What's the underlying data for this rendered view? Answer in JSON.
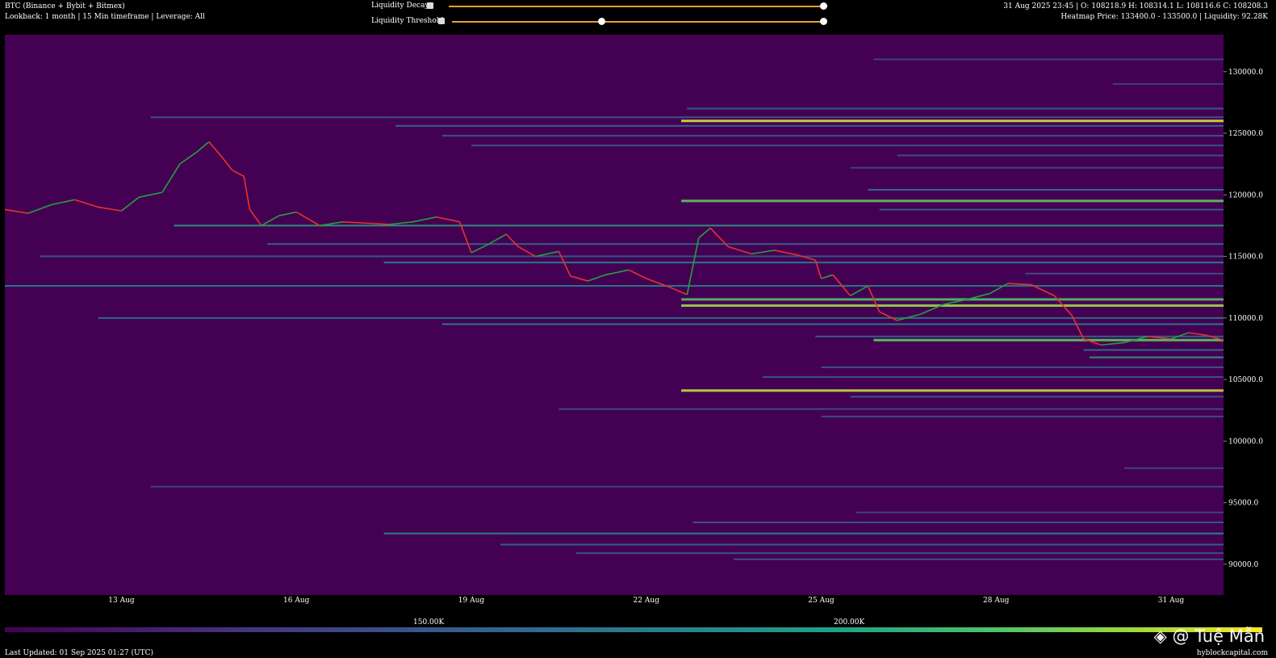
{
  "header": {
    "title": "BTC (Binance + Bybit + Bitmex)",
    "subtitle": "Lookback: 1 month | 15 Min timeframe | Leverage: All",
    "ohlc": "31 Aug 2025 23:45 | O: 108218.9 H: 108314.1 L: 108116.6 C: 108208.3",
    "heatmap_info": "Heatmap Price: 133400.0 - 133500.0 | Liquidity: 92.28K"
  },
  "controls": {
    "decay_label": "Liquidity Decay",
    "threshold_label": "Liquidity Threshold",
    "decay_range": [
      0.0,
      1.0
    ],
    "threshold_range": [
      0.4,
      1.0
    ]
  },
  "colorbar": {
    "label_1": "150.00K",
    "label_2": "200.00K",
    "colors": [
      "#440154",
      "#3b528b",
      "#21918c",
      "#5ec962",
      "#fde725"
    ]
  },
  "footer": {
    "updated": "Last Updated: 01 Sep 2025 01:27 (UTC)",
    "site": "hyblockcapital.com"
  },
  "watermark": "@ Tuệ Mẫn",
  "chart_data": {
    "type": "heatmap",
    "background_color": "#440154",
    "x_start_day": 11,
    "x_end_day": 31.9,
    "ylim": [
      87500,
      133000
    ],
    "x_ticks": [
      {
        "label": "13 Aug",
        "day": 13
      },
      {
        "label": "16 Aug",
        "day": 16
      },
      {
        "label": "19 Aug",
        "day": 19
      },
      {
        "label": "22 Aug",
        "day": 22
      },
      {
        "label": "25 Aug",
        "day": 25
      },
      {
        "label": "28 Aug",
        "day": 28
      },
      {
        "label": "31 Aug",
        "day": 31
      }
    ],
    "y_ticks": [
      {
        "label": "130000.0",
        "value": 130000
      },
      {
        "label": "125000.0",
        "value": 125000
      },
      {
        "label": "120000.0",
        "value": 120000
      },
      {
        "label": "115000.0",
        "value": 115000
      },
      {
        "label": "110000.0",
        "value": 110000
      },
      {
        "label": "105000.0",
        "value": 105000
      },
      {
        "label": "100000.0",
        "value": 100000
      },
      {
        "label": "95000.0",
        "value": 95000
      },
      {
        "label": "90000.0",
        "value": 90000
      }
    ],
    "price_series": [
      [
        11.0,
        118800
      ],
      [
        11.4,
        118500
      ],
      [
        11.8,
        119200
      ],
      [
        12.2,
        119600
      ],
      [
        12.6,
        119000
      ],
      [
        13.0,
        118700
      ],
      [
        13.3,
        119800
      ],
      [
        13.7,
        120200
      ],
      [
        14.0,
        122500
      ],
      [
        14.3,
        123500
      ],
      [
        14.5,
        124300
      ],
      [
        14.7,
        123200
      ],
      [
        14.9,
        122000
      ],
      [
        15.1,
        121500
      ],
      [
        15.2,
        118800
      ],
      [
        15.4,
        117500
      ],
      [
        15.7,
        118300
      ],
      [
        16.0,
        118600
      ],
      [
        16.4,
        117500
      ],
      [
        16.8,
        117800
      ],
      [
        17.2,
        117700
      ],
      [
        17.6,
        117600
      ],
      [
        18.0,
        117800
      ],
      [
        18.4,
        118200
      ],
      [
        18.8,
        117800
      ],
      [
        19.0,
        115300
      ],
      [
        19.3,
        116000
      ],
      [
        19.6,
        116800
      ],
      [
        19.8,
        115800
      ],
      [
        20.1,
        115000
      ],
      [
        20.5,
        115400
      ],
      [
        20.7,
        113400
      ],
      [
        21.0,
        113000
      ],
      [
        21.3,
        113500
      ],
      [
        21.7,
        113900
      ],
      [
        22.0,
        113200
      ],
      [
        22.4,
        112500
      ],
      [
        22.7,
        111900
      ],
      [
        22.9,
        116500
      ],
      [
        23.1,
        117300
      ],
      [
        23.4,
        115800
      ],
      [
        23.8,
        115200
      ],
      [
        24.2,
        115500
      ],
      [
        24.6,
        115100
      ],
      [
        24.9,
        114700
      ],
      [
        25.0,
        113200
      ],
      [
        25.2,
        113500
      ],
      [
        25.5,
        111800
      ],
      [
        25.8,
        112600
      ],
      [
        26.0,
        110500
      ],
      [
        26.3,
        109800
      ],
      [
        26.7,
        110300
      ],
      [
        27.1,
        111100
      ],
      [
        27.5,
        111500
      ],
      [
        27.9,
        112000
      ],
      [
        28.2,
        112800
      ],
      [
        28.6,
        112700
      ],
      [
        29.0,
        111800
      ],
      [
        29.3,
        110200
      ],
      [
        29.5,
        108300
      ],
      [
        29.8,
        107800
      ],
      [
        30.2,
        108000
      ],
      [
        30.6,
        108500
      ],
      [
        31.0,
        108300
      ],
      [
        31.3,
        108800
      ],
      [
        31.6,
        108600
      ],
      [
        31.9,
        108200
      ]
    ],
    "liquidity_bands": [
      {
        "price": 131000,
        "start": 25.9,
        "intensity": 0.22
      },
      {
        "price": 129000,
        "start": 30.0,
        "intensity": 0.2
      },
      {
        "price": 127000,
        "start": 22.7,
        "intensity": 0.32
      },
      {
        "price": 126300,
        "start": 13.5,
        "intensity": 0.3
      },
      {
        "price": 126000,
        "start": 22.6,
        "intensity": 0.95
      },
      {
        "price": 125600,
        "start": 17.7,
        "intensity": 0.35
      },
      {
        "price": 124800,
        "start": 18.5,
        "intensity": 0.3
      },
      {
        "price": 124000,
        "start": 19.0,
        "intensity": 0.28
      },
      {
        "price": 123200,
        "start": 26.3,
        "intensity": 0.25
      },
      {
        "price": 122200,
        "start": 25.5,
        "intensity": 0.22
      },
      {
        "price": 120400,
        "start": 25.8,
        "intensity": 0.4
      },
      {
        "price": 119500,
        "start": 22.6,
        "intensity": 0.75
      },
      {
        "price": 118800,
        "start": 26.0,
        "intensity": 0.3
      },
      {
        "price": 117500,
        "start": 13.9,
        "intensity": 0.55
      },
      {
        "price": 116000,
        "start": 15.5,
        "intensity": 0.35
      },
      {
        "price": 115000,
        "start": 11.6,
        "intensity": 0.3
      },
      {
        "price": 114500,
        "start": 17.5,
        "intensity": 0.45
      },
      {
        "price": 113600,
        "start": 28.5,
        "intensity": 0.25
      },
      {
        "price": 112600,
        "start": 11.0,
        "intensity": 0.45
      },
      {
        "price": 111500,
        "start": 22.6,
        "intensity": 0.7
      },
      {
        "price": 111000,
        "start": 22.6,
        "intensity": 0.85
      },
      {
        "price": 110000,
        "start": 12.6,
        "intensity": 0.4
      },
      {
        "price": 109500,
        "start": 18.5,
        "intensity": 0.45
      },
      {
        "price": 108500,
        "start": 24.9,
        "intensity": 0.35
      },
      {
        "price": 108200,
        "start": 25.9,
        "intensity": 0.75
      },
      {
        "price": 107400,
        "start": 29.5,
        "intensity": 0.4
      },
      {
        "price": 106800,
        "start": 29.6,
        "intensity": 0.55
      },
      {
        "price": 106000,
        "start": 25.0,
        "intensity": 0.3
      },
      {
        "price": 105200,
        "start": 24.0,
        "intensity": 0.28
      },
      {
        "price": 104100,
        "start": 22.6,
        "intensity": 0.9
      },
      {
        "price": 103600,
        "start": 25.5,
        "intensity": 0.3
      },
      {
        "price": 102600,
        "start": 20.5,
        "intensity": 0.25
      },
      {
        "price": 102000,
        "start": 25.0,
        "intensity": 0.25
      },
      {
        "price": 97800,
        "start": 30.2,
        "intensity": 0.22
      },
      {
        "price": 96300,
        "start": 13.5,
        "intensity": 0.22
      },
      {
        "price": 94200,
        "start": 25.6,
        "intensity": 0.22
      },
      {
        "price": 93400,
        "start": 22.8,
        "intensity": 0.3
      },
      {
        "price": 92500,
        "start": 17.5,
        "intensity": 0.5
      },
      {
        "price": 91600,
        "start": 19.5,
        "intensity": 0.35
      },
      {
        "price": 90900,
        "start": 20.8,
        "intensity": 0.3
      },
      {
        "price": 90400,
        "start": 23.5,
        "intensity": 0.28
      }
    ]
  }
}
